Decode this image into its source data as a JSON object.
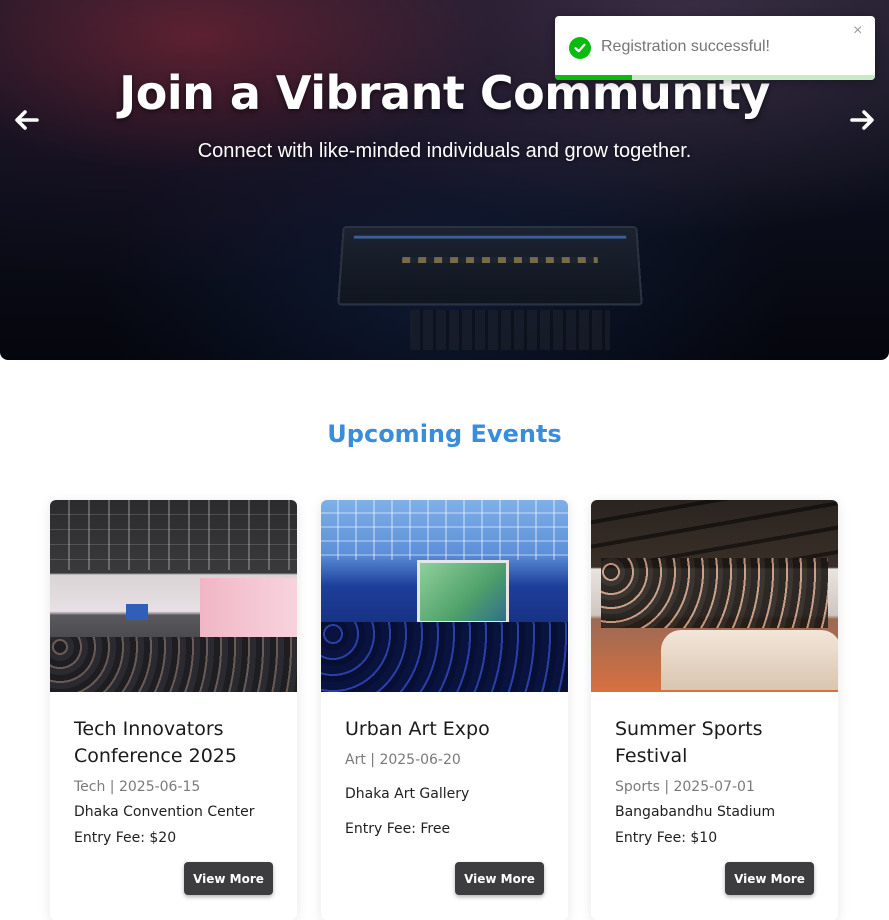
{
  "hero": {
    "title": "Join a Vibrant Community",
    "subtitle": "Connect with like-minded individuals and grow together.",
    "prev_icon": "arrow-left-icon",
    "next_icon": "arrow-right-icon"
  },
  "toast": {
    "message": "Registration successful!",
    "close_label": "×",
    "icon": "check-circle-icon",
    "progress_fraction": 0.24,
    "accent_color": "#07bc0c"
  },
  "section": {
    "title": "Upcoming Events",
    "title_color": "#3a8ddb"
  },
  "events": [
    {
      "title": "Tech Innovators Conference 2025",
      "meta": "Tech | 2025-06-15",
      "location": "Dhaka Convention Center",
      "fee": "Entry Fee: $20",
      "button": "View More"
    },
    {
      "title": "Urban Art Expo",
      "meta": "Art | 2025-06-20",
      "location": "Dhaka Art Gallery",
      "fee": "Entry Fee: Free",
      "button": "View More"
    },
    {
      "title": "Summer Sports Festival",
      "meta": "Sports | 2025-07-01",
      "location": "Bangabandhu Stadium",
      "fee": "Entry Fee: $10",
      "button": "View More"
    }
  ]
}
